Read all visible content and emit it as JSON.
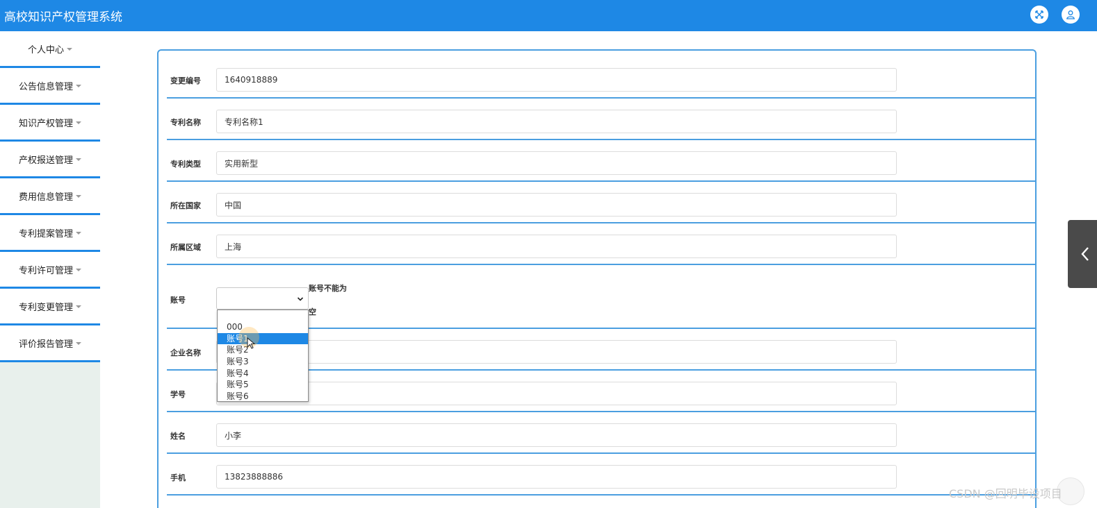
{
  "app": {
    "title": "高校知识产权管理系统"
  },
  "header": {
    "fullscreen_icon": "expand-arrows-icon",
    "user_icon": "user-icon"
  },
  "sidebar": {
    "items": [
      {
        "label": "个人中心"
      },
      {
        "label": "公告信息管理"
      },
      {
        "label": "知识产权管理"
      },
      {
        "label": "产权报送管理"
      },
      {
        "label": "费用信息管理"
      },
      {
        "label": "专利提案管理"
      },
      {
        "label": "专利许可管理"
      },
      {
        "label": "专利变更管理"
      },
      {
        "label": "评价报告管理"
      }
    ]
  },
  "form": {
    "change_no": {
      "label": "变更编号",
      "value": "1640918889"
    },
    "patent_name": {
      "label": "专利名称",
      "value": "专利名称1"
    },
    "patent_type": {
      "label": "专利类型",
      "value": "实用新型"
    },
    "country": {
      "label": "所在国家",
      "value": "中国"
    },
    "region": {
      "label": "所属区域",
      "value": "上海"
    },
    "account": {
      "label": "账号",
      "value": "",
      "error_line1": "账号不能为",
      "error_line2": "空",
      "options": [
        "000",
        "账号1",
        "账号2",
        "账号3",
        "账号4",
        "账号5",
        "账号6"
      ],
      "highlighted": "账号1"
    },
    "company": {
      "label": "企业名称",
      "value": ""
    },
    "student_no": {
      "label": "学号",
      "value": ""
    },
    "name": {
      "label": "姓名",
      "value": "小李"
    },
    "phone": {
      "label": "手机",
      "value": "13823888886"
    }
  },
  "watermark": "CSDN @回明毕设项目",
  "colors": {
    "primary": "#1e88e5",
    "border": "#4a9ee0",
    "sidebar_bg": "#e8f0ec"
  }
}
